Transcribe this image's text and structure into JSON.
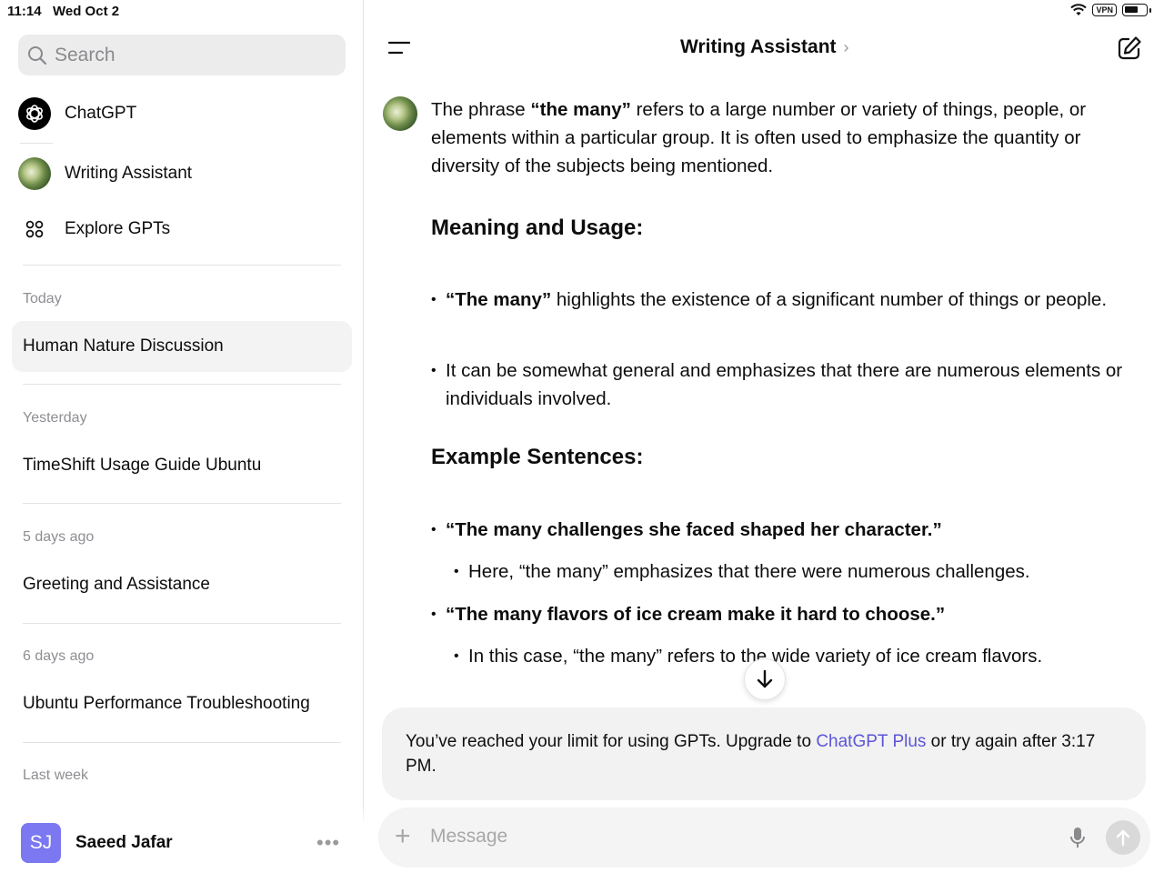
{
  "status_bar": {
    "time": "11:14",
    "date": "Wed Oct 2",
    "vpn_label": "VPN"
  },
  "sidebar": {
    "search_placeholder": "Search",
    "nav": [
      {
        "label": "ChatGPT",
        "icon": "openai-logo-icon"
      },
      {
        "label": "Writing Assistant",
        "icon": "writing-assistant-avatar"
      },
      {
        "label": "Explore GPTs",
        "icon": "grid-icon"
      }
    ],
    "sections": [
      {
        "label": "Today",
        "chats": [
          "Human Nature Discussion"
        ]
      },
      {
        "label": "Yesterday",
        "chats": [
          "TimeShift Usage Guide Ubuntu"
        ]
      },
      {
        "label": "5 days ago",
        "chats": [
          "Greeting and Assistance"
        ]
      },
      {
        "label": "6 days ago",
        "chats": [
          "Ubuntu Performance Troubleshooting"
        ]
      },
      {
        "label": "Last week",
        "chats": []
      }
    ],
    "user": {
      "initials": "SJ",
      "name": "Saeed Jafar"
    }
  },
  "main": {
    "title": "Writing Assistant",
    "title_chevron": "›",
    "message": {
      "intro_prefix": "The phrase ",
      "intro_bold": "“the many”",
      "intro_suffix": " refers to a large number or variety of things, people, or elements within a particular group. It is often used to emphasize the quantity or diversity of the subjects being mentioned.",
      "heading_1": "Meaning and Usage:",
      "bullet_1_bold": "“The many”",
      "bullet_1_text": " highlights the existence of a significant number of things or people.",
      "bullet_2_text": "It can be somewhat general and emphasizes that there are numerous elements or individuals involved.",
      "heading_2": "Example Sentences:",
      "example_1": "“The many challenges she faced shaped her character.”",
      "example_1_sub": "Here, “the many” emphasizes that there were numerous challenges.",
      "example_2": "“The many flavors of ice cream make it hard to choose.”",
      "example_2_sub": "In this case, “the many” refers to the wide variety of ice cream flavors."
    },
    "limit_banner": {
      "prefix": "You’ve reached your limit for using GPTs. Upgrade to ",
      "link": "ChatGPT Plus",
      "suffix": " or try again after 3:17 PM."
    },
    "composer": {
      "placeholder": "Message"
    }
  },
  "colors": {
    "accent_link": "#5b55d6",
    "user_avatar": "#7b78f2",
    "banner_bg": "#f2f2f2"
  }
}
